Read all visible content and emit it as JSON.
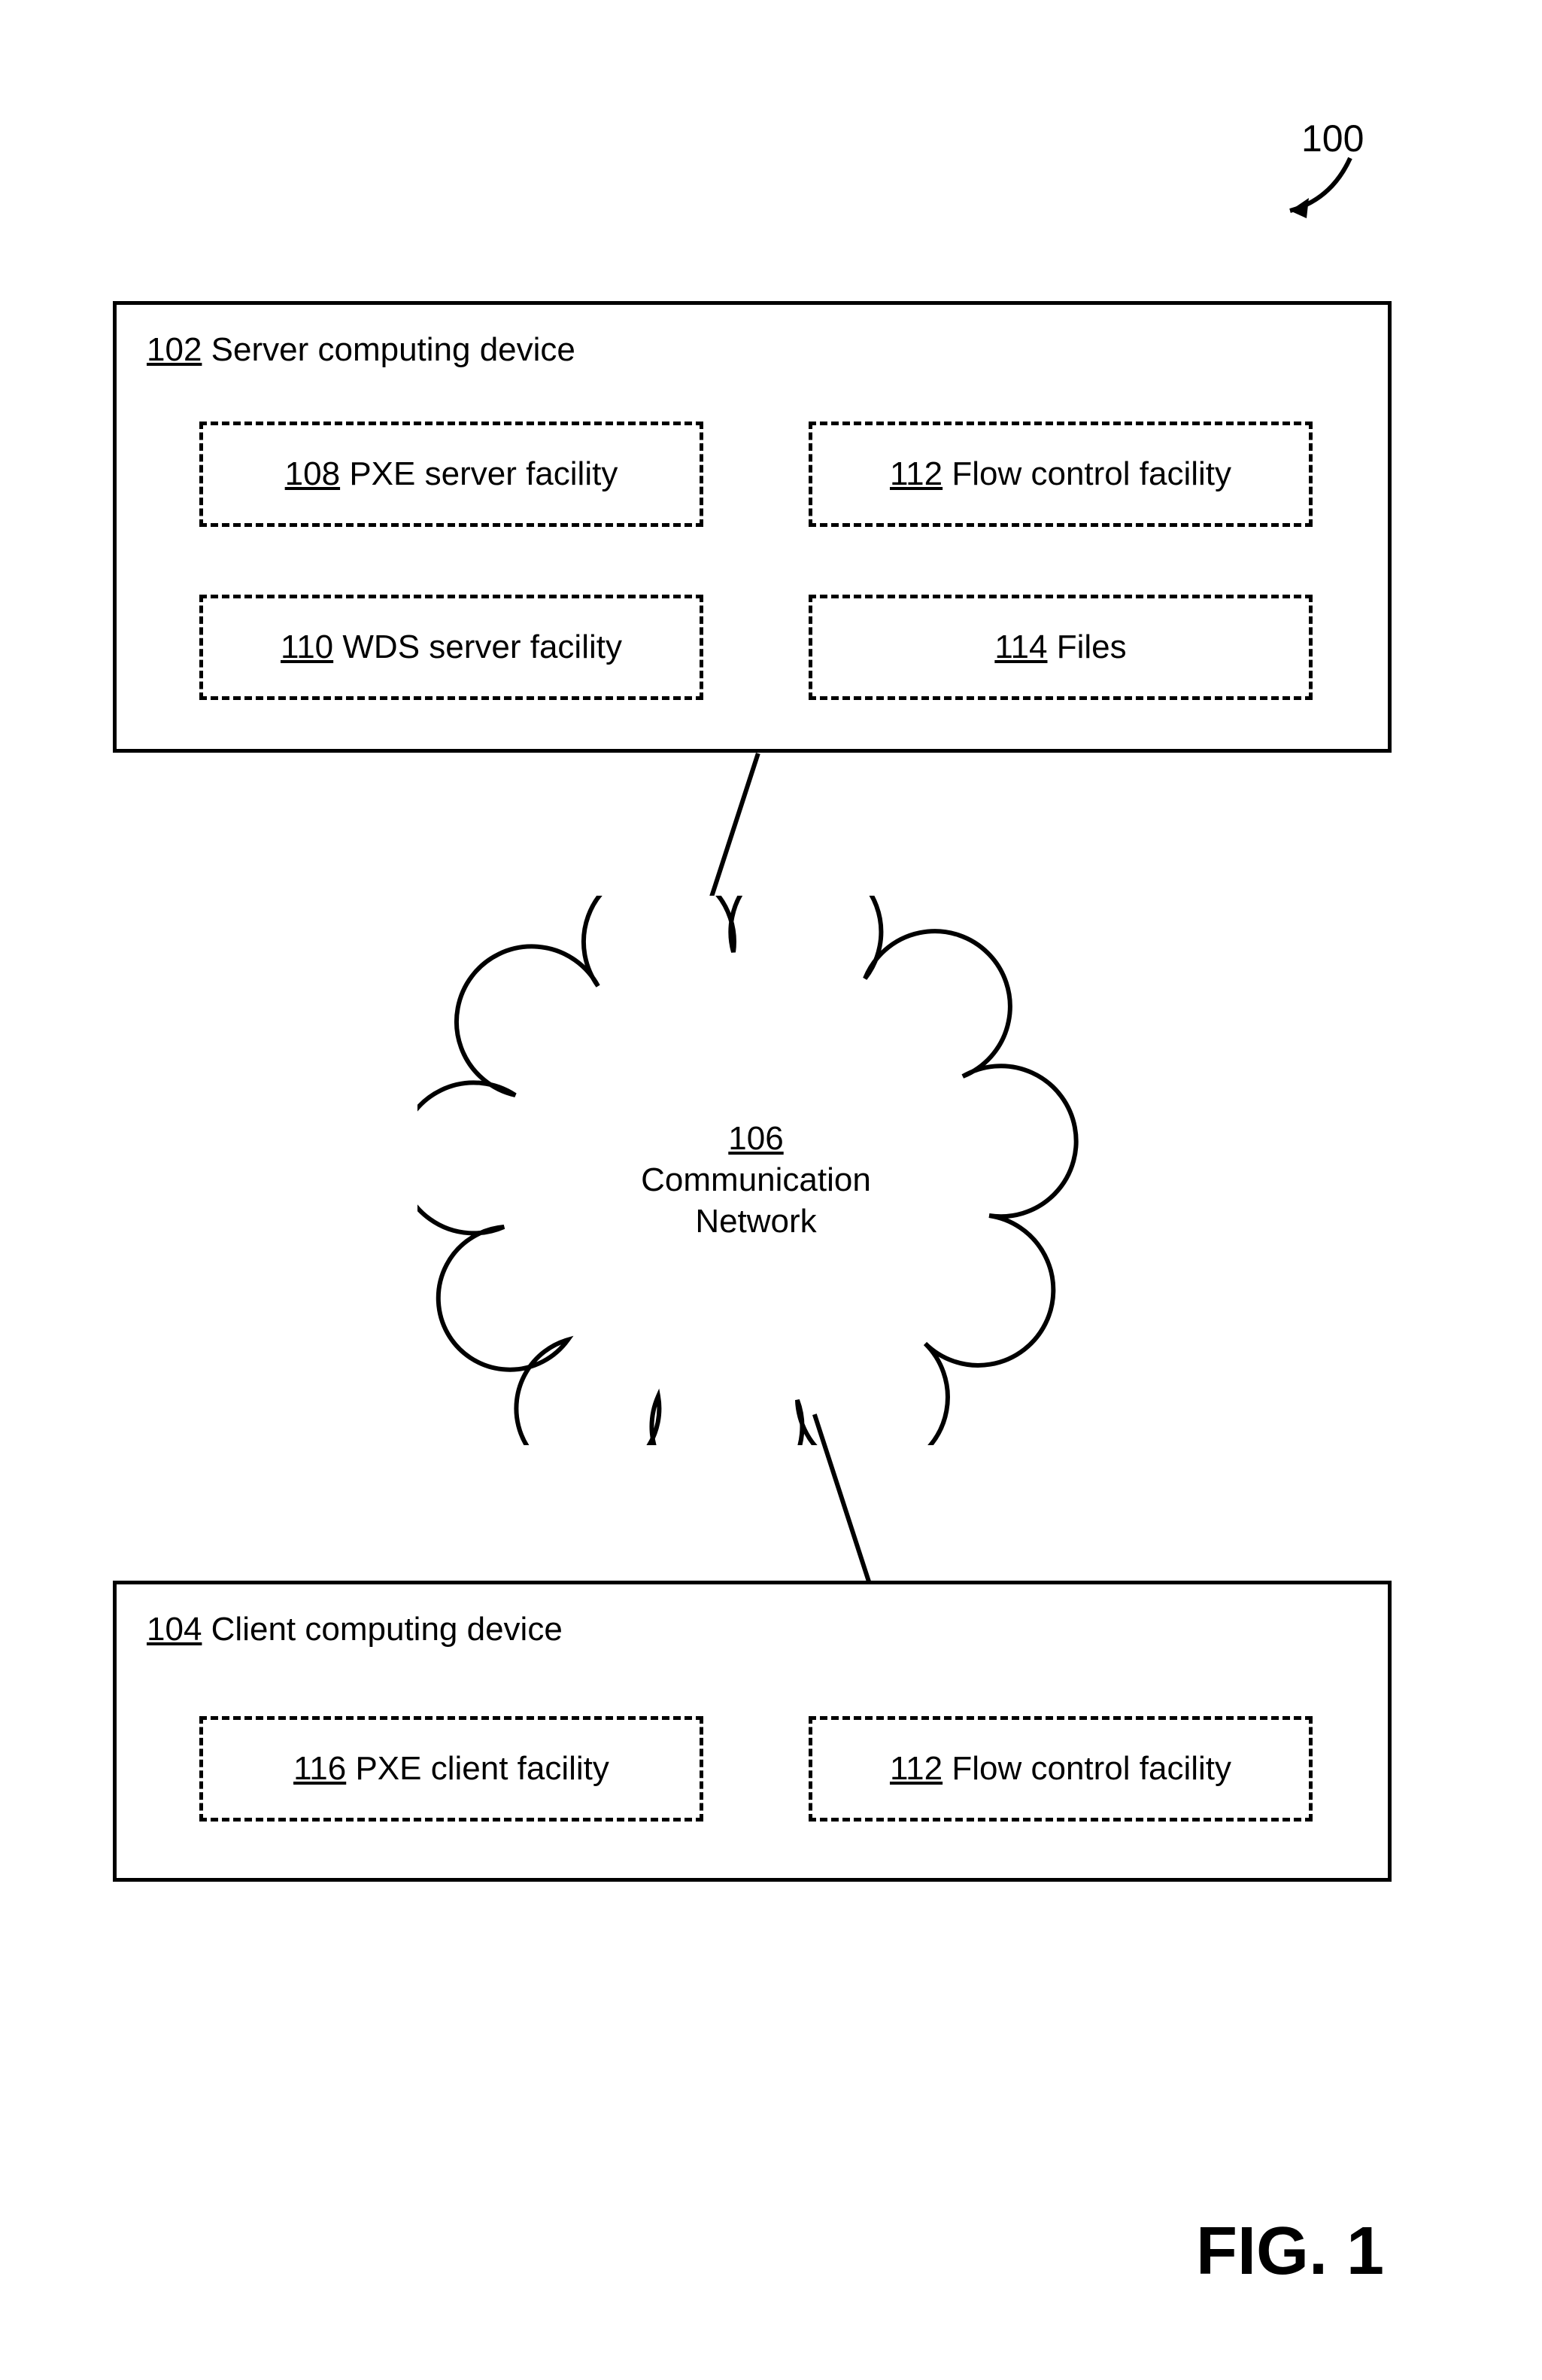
{
  "figure": {
    "ref": "100",
    "caption": "FIG. 1"
  },
  "server": {
    "num": "102",
    "label": "Server computing device",
    "boxes": {
      "pxe_server": {
        "num": "108",
        "label": "PXE server facility"
      },
      "flow_control": {
        "num": "112",
        "label": "Flow control facility"
      },
      "wds_server": {
        "num": "110",
        "label": "WDS server facility"
      },
      "files": {
        "num": "114",
        "label": "Files"
      }
    }
  },
  "network": {
    "num": "106",
    "label_line1": "Communication",
    "label_line2": "Network"
  },
  "client": {
    "num": "104",
    "label": "Client computing device",
    "boxes": {
      "pxe_client": {
        "num": "116",
        "label": "PXE client facility"
      },
      "flow_control": {
        "num": "112",
        "label": "Flow control facility"
      }
    }
  }
}
